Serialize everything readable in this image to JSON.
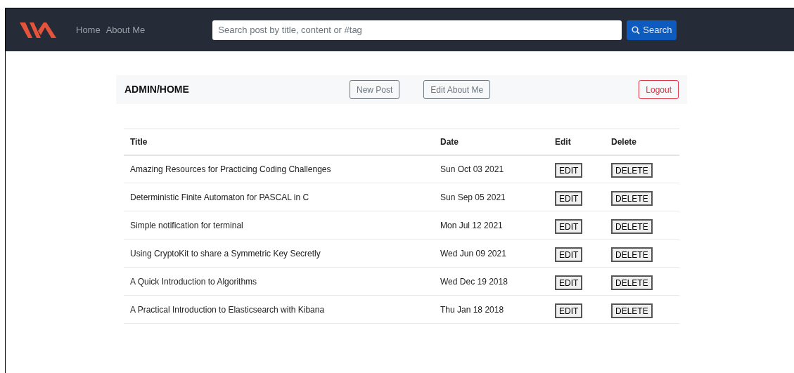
{
  "navbar": {
    "links": [
      "Home",
      "About Me"
    ],
    "search": {
      "placeholder": "Search post by title, content or #tag"
    },
    "search_button": "Search"
  },
  "admin_bar": {
    "title": "ADMIN/HOME",
    "buttons": [
      {
        "label": "New Post",
        "kind": "secondary"
      },
      {
        "label": "Edit About Me",
        "kind": "secondary"
      },
      {
        "label": "Logout",
        "kind": "danger"
      }
    ]
  },
  "table": {
    "columns": [
      "Title",
      "Date",
      "Edit",
      "Delete"
    ],
    "rows": [
      {
        "title": "Amazing Resources for Practicing Coding Challenges",
        "date": "Sun Oct 03 2021",
        "edit": "EDIT",
        "delete": "DELETE"
      },
      {
        "title": "Deterministic Finite Automaton for PASCAL in C",
        "date": "Sun Sep 05 2021",
        "edit": "EDIT",
        "delete": "DELETE"
      },
      {
        "title": "Simple notification for terminal",
        "date": "Mon Jul 12 2021",
        "edit": "EDIT",
        "delete": "DELETE"
      },
      {
        "title": "Using CryptoKit to share a Symmetric Key Secretly",
        "date": "Wed Jun 09 2021",
        "edit": "EDIT",
        "delete": "DELETE"
      },
      {
        "title": "A Quick Introduction to Algorithms",
        "date": "Wed Dec 19 2018",
        "edit": "EDIT",
        "delete": "DELETE"
      },
      {
        "title": "A Practical Introduction to Elasticsearch with Kibana",
        "date": "Thu Jan 18 2018",
        "edit": "EDIT",
        "delete": "DELETE"
      }
    ]
  }
}
